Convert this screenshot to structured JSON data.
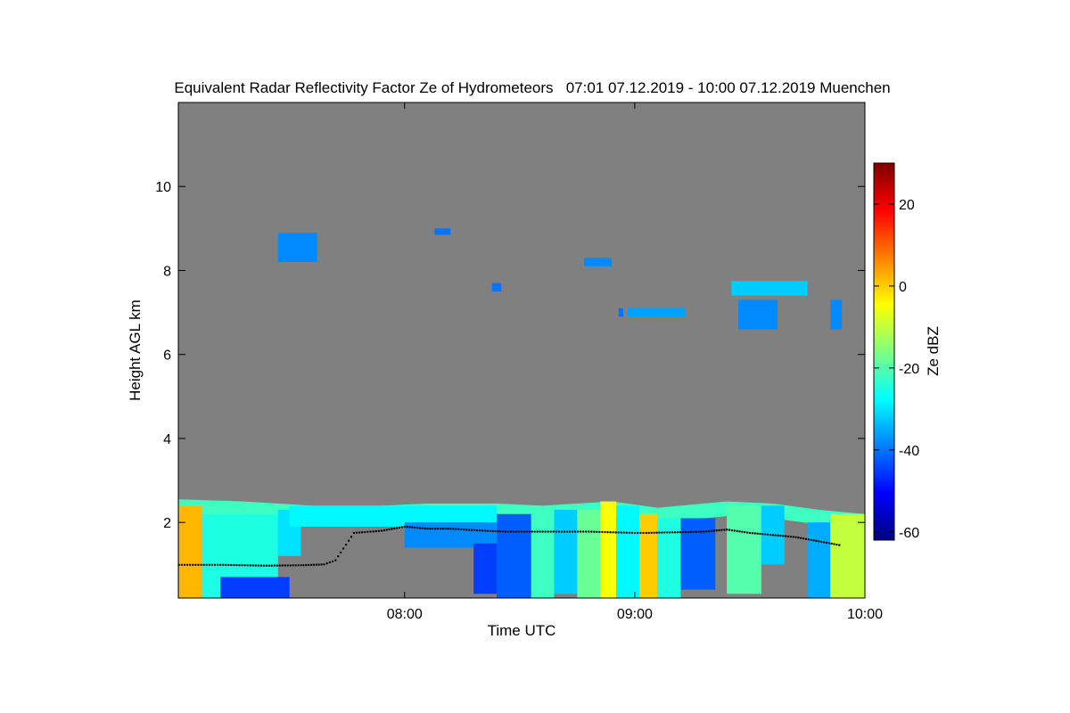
{
  "chart_data": {
    "type": "heatmap",
    "title": "Equivalent Radar Reflectivity Factor Ze of Hydrometeors   07:01 07.12.2019 - 10:00 07.12.2019 Muenchen",
    "xlabel": "Time UTC",
    "ylabel": "Height AGL km",
    "colorbar_label": "Ze dBZ",
    "x_unit": "hours UTC",
    "xlim": [
      7.017,
      10.0
    ],
    "ylim": [
      0.2,
      12.0
    ],
    "zlim": [
      -62,
      30
    ],
    "x_ticks": [
      {
        "value": 8,
        "label": "08:00"
      },
      {
        "value": 9,
        "label": "09:00"
      },
      {
        "value": 10,
        "label": "10:00"
      }
    ],
    "y_ticks": [
      {
        "value": 2,
        "label": "2"
      },
      {
        "value": 4,
        "label": "4"
      },
      {
        "value": 6,
        "label": "6"
      },
      {
        "value": 8,
        "label": "8"
      },
      {
        "value": 10,
        "label": "10"
      }
    ],
    "colorbar_ticks": [
      {
        "value": 20,
        "label": "20"
      },
      {
        "value": 0,
        "label": "0"
      },
      {
        "value": -20,
        "label": "-20"
      },
      {
        "value": -40,
        "label": "-40"
      },
      {
        "value": -60,
        "label": "-60"
      }
    ],
    "colormap": [
      "#00007f",
      "#0000ff",
      "#007fff",
      "#00ffff",
      "#7fff7f",
      "#ffff00",
      "#ff7f00",
      "#ff0000",
      "#7f0000"
    ],
    "no_signal_color": "#808080",
    "low_cloud_deck": {
      "top_km": [
        [
          7.02,
          2.55
        ],
        [
          7.3,
          2.5
        ],
        [
          7.6,
          2.4
        ],
        [
          7.9,
          2.4
        ],
        [
          8.1,
          2.45
        ],
        [
          8.4,
          2.45
        ],
        [
          8.6,
          2.4
        ],
        [
          8.9,
          2.5
        ],
        [
          9.1,
          2.35
        ],
        [
          9.4,
          2.5
        ],
        [
          9.6,
          2.45
        ],
        [
          9.8,
          2.3
        ],
        [
          10.0,
          2.2
        ]
      ],
      "cells": [
        {
          "t0": 7.02,
          "t1": 7.12,
          "h0": 0.2,
          "h1": 2.4,
          "dbz": 2
        },
        {
          "t0": 7.12,
          "t1": 7.45,
          "h0": 0.2,
          "h1": 2.2,
          "dbz": -25
        },
        {
          "t0": 7.45,
          "t1": 7.55,
          "h0": 1.2,
          "h1": 2.3,
          "dbz": -30
        },
        {
          "t0": 7.2,
          "t1": 7.5,
          "h0": 0.2,
          "h1": 0.7,
          "dbz": -45
        },
        {
          "t0": 7.5,
          "t1": 8.4,
          "h0": 1.9,
          "h1": 2.4,
          "dbz": -28
        },
        {
          "t0": 8.0,
          "t1": 8.4,
          "h0": 1.4,
          "h1": 2.0,
          "dbz": -38
        },
        {
          "t0": 8.3,
          "t1": 8.4,
          "h0": 0.3,
          "h1": 1.5,
          "dbz": -45
        },
        {
          "t0": 8.4,
          "t1": 8.55,
          "h0": 0.2,
          "h1": 2.2,
          "dbz": -42
        },
        {
          "t0": 8.55,
          "t1": 8.65,
          "h0": 0.2,
          "h1": 2.3,
          "dbz": -22
        },
        {
          "t0": 8.65,
          "t1": 8.75,
          "h0": 0.3,
          "h1": 2.3,
          "dbz": -32
        },
        {
          "t0": 8.75,
          "t1": 8.85,
          "h0": 0.2,
          "h1": 2.3,
          "dbz": -18
        },
        {
          "t0": 8.85,
          "t1": 8.92,
          "h0": 0.2,
          "h1": 2.5,
          "dbz": -5
        },
        {
          "t0": 8.92,
          "t1": 9.02,
          "h0": 0.2,
          "h1": 2.4,
          "dbz": -28
        },
        {
          "t0": 9.02,
          "t1": 9.1,
          "h0": 0.2,
          "h1": 2.2,
          "dbz": 0
        },
        {
          "t0": 9.1,
          "t1": 9.2,
          "h0": 0.2,
          "h1": 2.1,
          "dbz": -25
        },
        {
          "t0": 9.2,
          "t1": 9.35,
          "h0": 0.4,
          "h1": 2.1,
          "dbz": -42
        },
        {
          "t0": 9.4,
          "t1": 9.55,
          "h0": 0.3,
          "h1": 2.4,
          "dbz": -20
        },
        {
          "t0": 9.55,
          "t1": 9.65,
          "h0": 1.0,
          "h1": 2.4,
          "dbz": -32
        },
        {
          "t0": 9.75,
          "t1": 9.85,
          "h0": 0.2,
          "h1": 2.0,
          "dbz": -35
        },
        {
          "t0": 9.85,
          "t1": 10.0,
          "h0": 0.2,
          "h1": 2.2,
          "dbz": -10
        }
      ]
    },
    "upper_cloud_patches": [
      {
        "t0": 7.45,
        "t1": 7.62,
        "h0": 8.2,
        "h1": 8.9,
        "dbz": -38
      },
      {
        "t0": 8.13,
        "t1": 8.2,
        "h0": 8.85,
        "h1": 9.0,
        "dbz": -40
      },
      {
        "t0": 8.38,
        "t1": 8.42,
        "h0": 7.5,
        "h1": 7.7,
        "dbz": -40
      },
      {
        "t0": 8.78,
        "t1": 8.9,
        "h0": 8.1,
        "h1": 8.3,
        "dbz": -38
      },
      {
        "t0": 8.93,
        "t1": 8.95,
        "h0": 6.9,
        "h1": 7.1,
        "dbz": -40
      },
      {
        "t0": 8.97,
        "t1": 9.22,
        "h0": 6.9,
        "h1": 7.1,
        "dbz": -36
      },
      {
        "t0": 9.42,
        "t1": 9.75,
        "h0": 7.4,
        "h1": 7.75,
        "dbz": -32
      },
      {
        "t0": 9.45,
        "t1": 9.62,
        "h0": 6.6,
        "h1": 7.3,
        "dbz": -38
      },
      {
        "t0": 9.85,
        "t1": 9.9,
        "h0": 6.6,
        "h1": 7.3,
        "dbz": -38
      }
    ],
    "cloud_base_km": [
      [
        7.02,
        0.99
      ],
      [
        7.2,
        0.99
      ],
      [
        7.4,
        0.97
      ],
      [
        7.55,
        0.98
      ],
      [
        7.65,
        1.0
      ],
      [
        7.7,
        1.1
      ],
      [
        7.78,
        1.75
      ],
      [
        7.9,
        1.8
      ],
      [
        8.0,
        1.9
      ],
      [
        8.1,
        1.85
      ],
      [
        8.2,
        1.85
      ],
      [
        8.35,
        1.8
      ],
      [
        8.45,
        1.78
      ],
      [
        8.6,
        1.78
      ],
      [
        8.8,
        1.78
      ],
      [
        9.0,
        1.75
      ],
      [
        9.05,
        1.75
      ],
      [
        9.3,
        1.78
      ],
      [
        9.4,
        1.83
      ],
      [
        9.5,
        1.75
      ],
      [
        9.6,
        1.7
      ],
      [
        9.7,
        1.65
      ],
      [
        9.8,
        1.55
      ],
      [
        9.9,
        1.45
      ]
    ]
  }
}
